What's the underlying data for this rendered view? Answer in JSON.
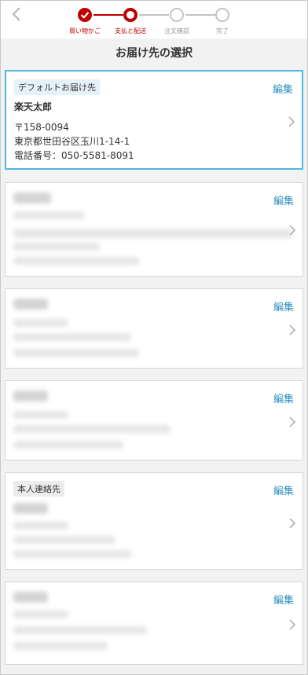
{
  "header": {
    "steps": [
      {
        "label": "買い物かご",
        "state": "done"
      },
      {
        "label": "支払と配送",
        "state": "current"
      },
      {
        "label": "注文確認",
        "state": "todo"
      },
      {
        "label": "完了",
        "state": "todo"
      }
    ]
  },
  "page_title": "お届け先の選択",
  "edit_label": "編集",
  "addresses": [
    {
      "tag": "デフォルトお届け先",
      "name": "楽天太郎",
      "postal": "〒158-0094",
      "address": "東京都世田谷区玉川1-14-1",
      "phone": "電話番号：050-5581-8091",
      "selected": true
    },
    {
      "tag": "",
      "redacted": true
    },
    {
      "tag": "",
      "redacted": true
    },
    {
      "tag": "",
      "redacted": true
    },
    {
      "tag": "本人連絡先",
      "redacted": true
    },
    {
      "tag": "",
      "redacted": true
    }
  ],
  "colors": {
    "accent_red": "#bf0000",
    "link_blue": "#2b8fbf",
    "selected_border": "#4fb8e0"
  }
}
